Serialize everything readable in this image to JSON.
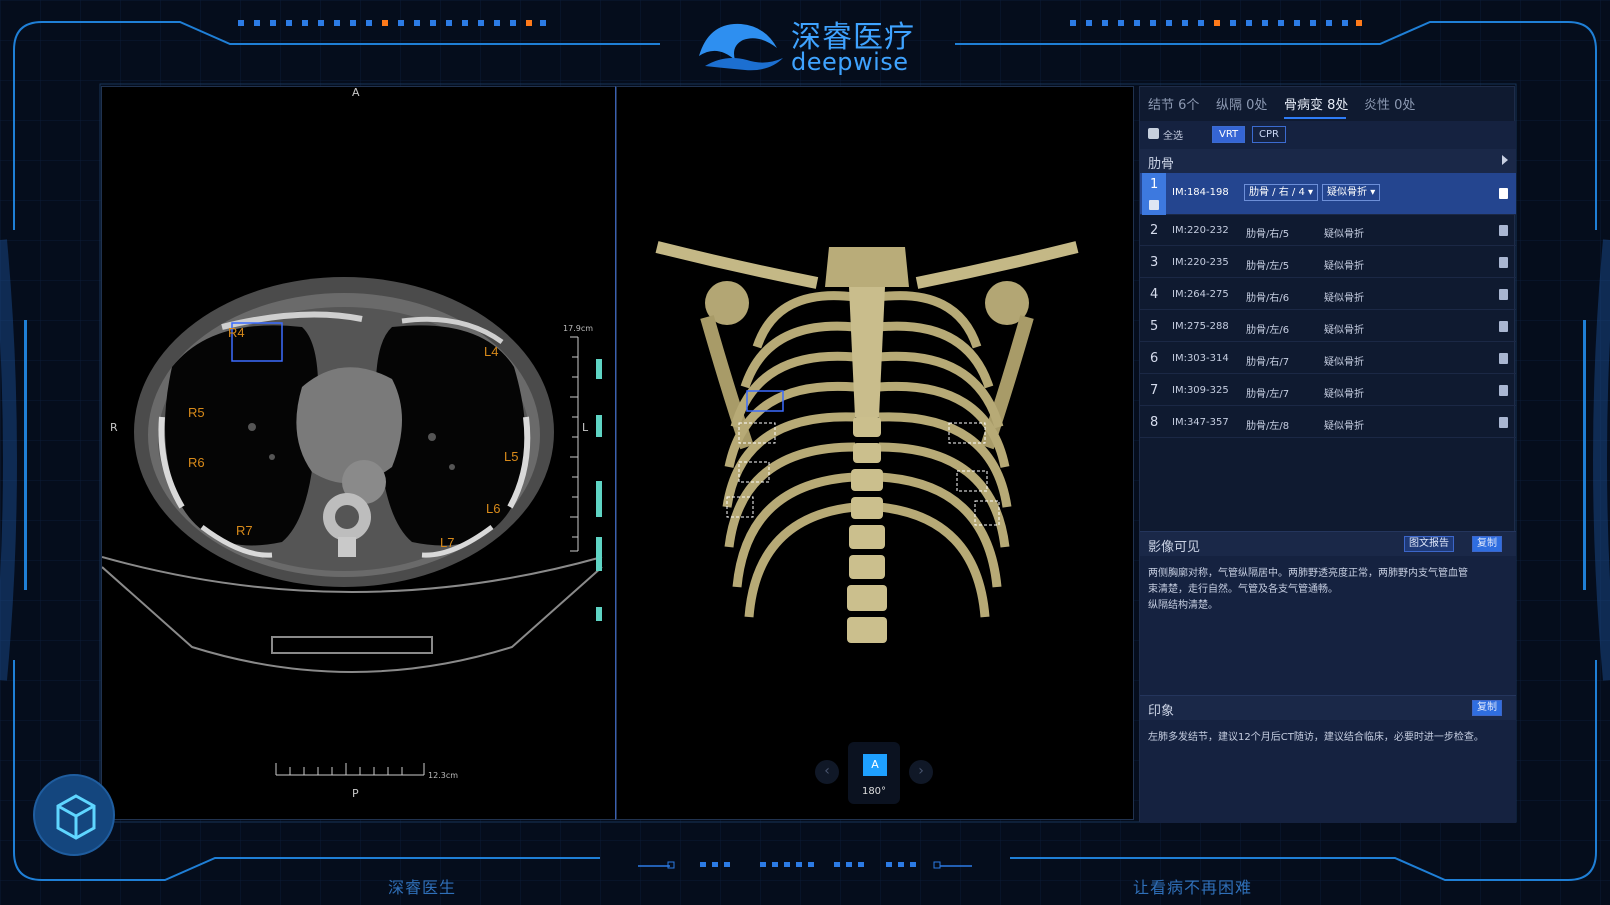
{
  "brand": {
    "name_cn": "深睿医疗",
    "name_en": "deepwise"
  },
  "footer": {
    "left": "深睿医生",
    "right": "让看病不再困难"
  },
  "colors": {
    "accent": "#1ea0ff",
    "panel_bg": "#0f1a30",
    "rib_label": "#d88a1a",
    "selected_row": "#24458f"
  },
  "axial_view": {
    "orient_top": "A",
    "orient_bottom": "P",
    "orient_left": "R",
    "orient_right": "L",
    "scale_vertical": "17.9cm",
    "scale_horizontal": "12.3cm",
    "rib_labels": [
      "R4",
      "R5",
      "R6",
      "R7",
      "L4",
      "L5",
      "L6",
      "L7"
    ]
  },
  "rotation": {
    "icon": "A",
    "angle": "180°",
    "prev_icon": "chevron-left-icon",
    "next_icon": "chevron-right-icon"
  },
  "tabs": [
    {
      "label": "结节 6个"
    },
    {
      "label": "纵隔 0处"
    },
    {
      "label": "骨病变 8处"
    },
    {
      "label": "炎性 0处"
    }
  ],
  "toolbar": {
    "select_all": "全选",
    "vrt": "VRT",
    "cpr": "CPR"
  },
  "section": {
    "title": "肋骨"
  },
  "lesions": [
    {
      "num": "1",
      "im": "IM:184-198",
      "location": "肋骨 / 右 / 4",
      "type": "疑似骨折"
    },
    {
      "num": "2",
      "im": "IM:220-232",
      "location": "肋骨/右/5",
      "type": "疑似骨折"
    },
    {
      "num": "3",
      "im": "IM:220-235",
      "location": "肋骨/左/5",
      "type": "疑似骨折"
    },
    {
      "num": "4",
      "im": "IM:264-275",
      "location": "肋骨/右/6",
      "type": "疑似骨折"
    },
    {
      "num": "5",
      "im": "IM:275-288",
      "location": "肋骨/左/6",
      "type": "疑似骨折"
    },
    {
      "num": "6",
      "im": "IM:303-314",
      "location": "肋骨/右/7",
      "type": "疑似骨折"
    },
    {
      "num": "7",
      "im": "IM:309-325",
      "location": "肋骨/左/7",
      "type": "疑似骨折"
    },
    {
      "num": "8",
      "im": "IM:347-357",
      "location": "肋骨/左/8",
      "type": "疑似骨折"
    }
  ],
  "findings": {
    "title": "影像可见",
    "report_btn": "图文报告",
    "copy_btn": "复制",
    "text_lines": [
      "两侧胸廓对称，气管纵隔居中。两肺野透亮度正常，两肺野内支气管血管",
      "束清楚，走行自然。气管及各支气管通畅。",
      "纵隔结构清楚。"
    ]
  },
  "impression": {
    "title": "印象",
    "copy_btn": "复制",
    "text": "左肺多发结节，建议12个月后CT随访，建议结合临床，必要时进一步检查。"
  }
}
